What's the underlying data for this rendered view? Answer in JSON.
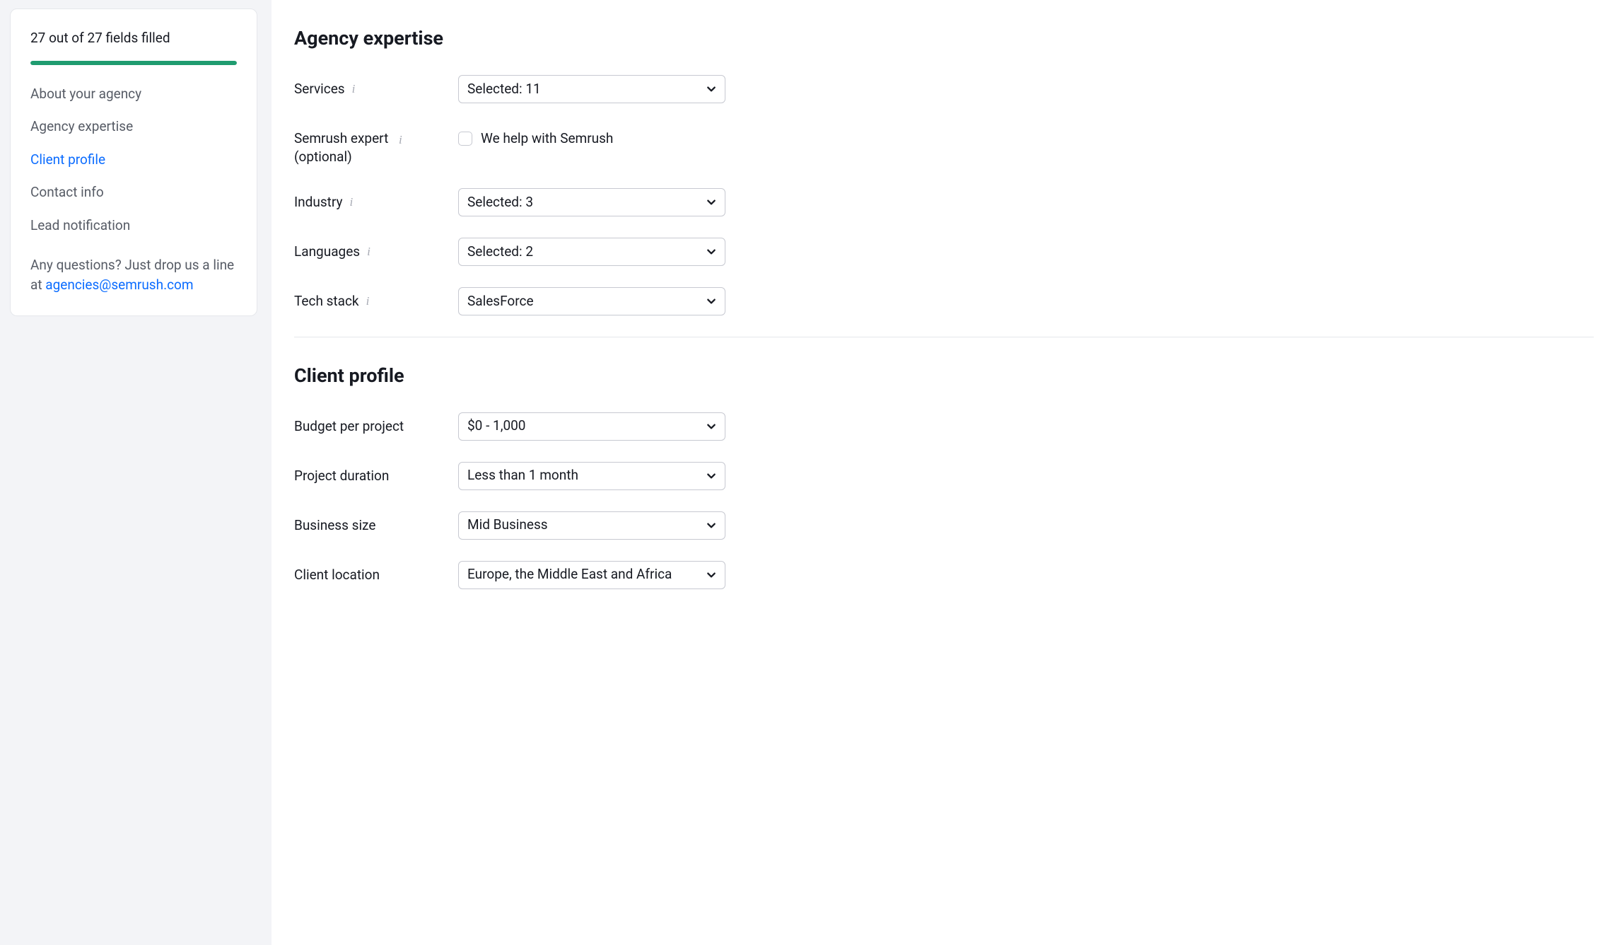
{
  "sidebar": {
    "progress_text": "27 out of 27 fields filled",
    "progress_pct": 100,
    "nav": [
      {
        "label": "About your agency",
        "active": false
      },
      {
        "label": "Agency expertise",
        "active": false
      },
      {
        "label": "Client profile",
        "active": true
      },
      {
        "label": "Contact info",
        "active": false
      },
      {
        "label": "Lead notification",
        "active": false
      }
    ],
    "help_prefix": "Any questions? Just drop us a line at ",
    "help_email": "agencies@semrush.com"
  },
  "sections": {
    "expertise": {
      "title": "Agency expertise",
      "fields": {
        "services": {
          "label": "Services",
          "value": "Selected: 11"
        },
        "semrush_expert": {
          "label": "Semrush expert",
          "sub": "(optional)",
          "checkbox_label": "We help with Semrush",
          "checked": false
        },
        "industry": {
          "label": "Industry",
          "value": "Selected: 3"
        },
        "languages": {
          "label": "Languages",
          "value": "Selected: 2"
        },
        "tech_stack": {
          "label": "Tech stack",
          "value": "SalesForce"
        }
      }
    },
    "client_profile": {
      "title": "Client profile",
      "fields": {
        "budget": {
          "label": "Budget per project",
          "value": "$0 - 1,000"
        },
        "duration": {
          "label": "Project duration",
          "value": "Less than 1 month"
        },
        "business_size": {
          "label": "Business size",
          "value": "Mid Business"
        },
        "client_location": {
          "label": "Client location",
          "value": "Europe, the Middle East and Africa"
        }
      }
    }
  }
}
